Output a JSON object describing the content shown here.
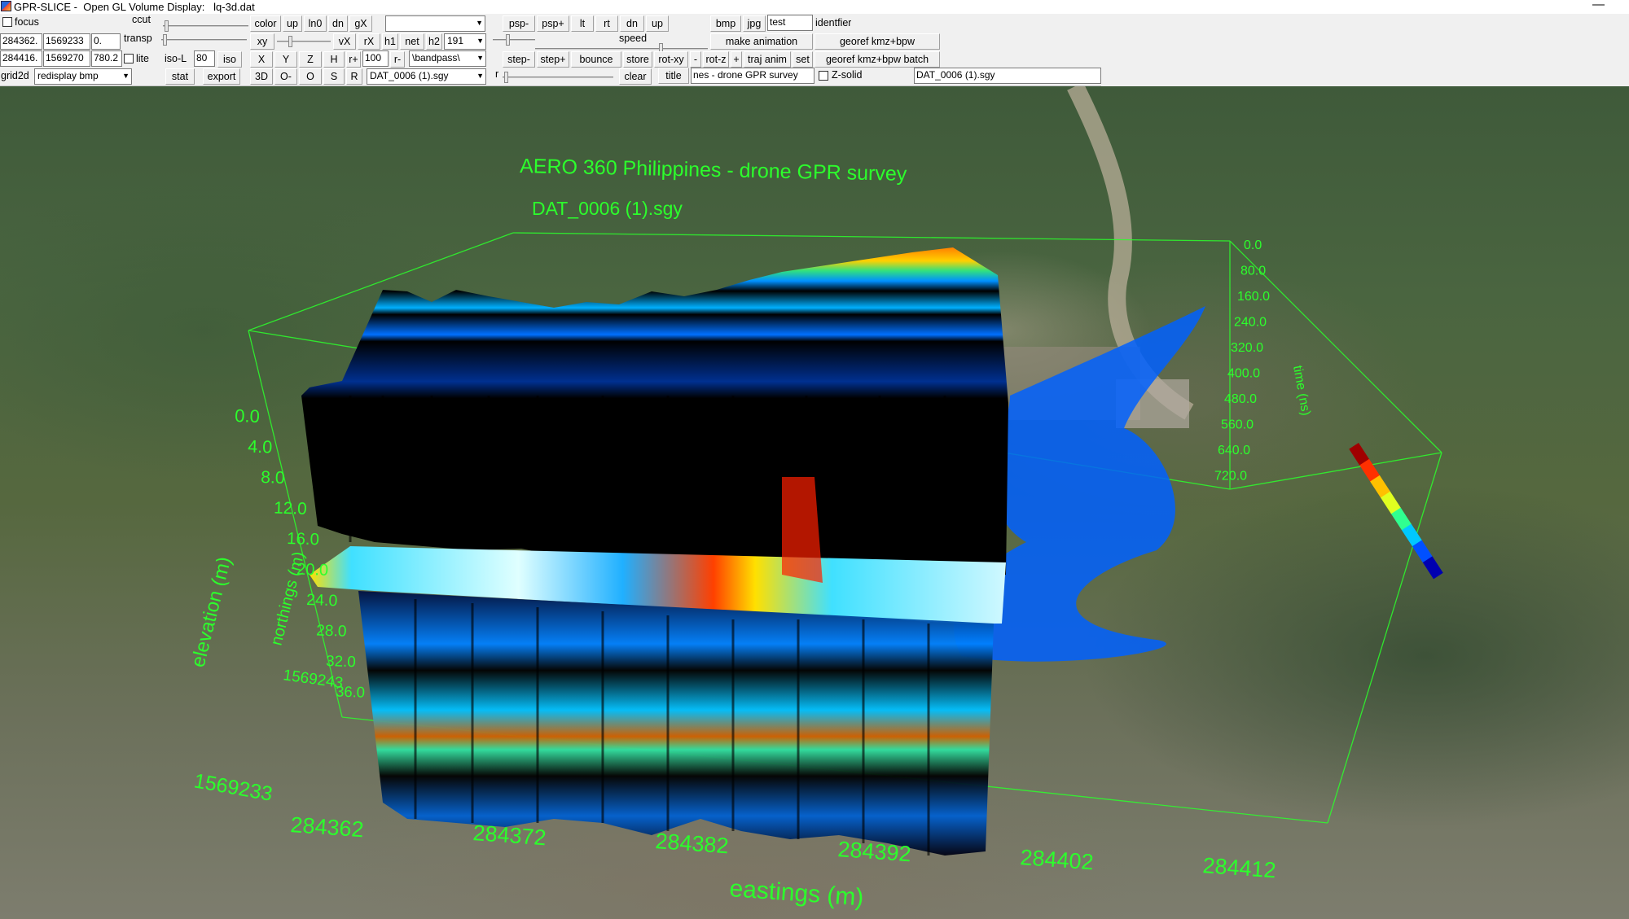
{
  "window": {
    "title": "GPR-SLICE -  Open GL Volume Display:   lq-3d.dat",
    "minimize": "—"
  },
  "toolbar": {
    "focus_label": "focus",
    "ccut_label": "ccut",
    "transp_label": "transp",
    "lite_label": "lite",
    "iso_l_label": "iso-L",
    "iso_value": "80",
    "iso_label": "iso",
    "grid2d_label": "grid2d",
    "redisplay_option": "redisplay bmp",
    "coord_row1": [
      "284362.",
      "1569233",
      "0."
    ],
    "coord_row2": [
      "284416.",
      "1569270",
      "780.2"
    ],
    "color": "color",
    "up": "up",
    "ln0": "ln0",
    "dn": "dn",
    "gx": "gX",
    "xy": "xy",
    "vx": "vX",
    "rx": "rX",
    "h1": "h1",
    "net": "net",
    "h2": "h2",
    "h2_value": "191",
    "stat": "stat",
    "export": "export",
    "x": "X",
    "y": "Y",
    "z": "Z",
    "h": "H",
    "r_plus": "r+",
    "r_value": "100",
    "r_minus": "r-",
    "filter_option": "\\bandpass\\",
    "view_3d": "3D",
    "o_minus": "O-",
    "o": "O",
    "s": "S",
    "r": "R",
    "file_option": "DAT_0006 (1).sgy",
    "r_slider_label": "r",
    "psp_minus": "psp-",
    "psp_plus": "psp+",
    "lt": "lt",
    "rt": "rt",
    "dn2": "dn",
    "up2": "up",
    "speed_label": "speed",
    "step_minus": "step-",
    "step_plus": "step+",
    "bounce": "bounce",
    "store": "store",
    "rot_xy": "rot-xy",
    "minus": "-",
    "rot_z": "rot-z",
    "plus": "+",
    "traj_anim": "traj anim",
    "set": "set",
    "clear": "clear",
    "title_btn": "title",
    "title_value": "nes - drone GPR survey",
    "zsolid_label": "Z-solid",
    "file_name": "DAT_0006 (1).sgy",
    "bmp": "bmp",
    "jpg": "jpg",
    "identifier_value": "test",
    "identifier_label": "identfier",
    "make_animation": "make animation",
    "georef": "georef kmz+bpw",
    "georef_batch": "georef kmz+bpw batch"
  },
  "viewport": {
    "title": "AERO 360 Philippines - drone GPR survey",
    "subtitle": "DAT_0006 (1).sgy",
    "elevation_label": "elevation (m)",
    "northings_label": "northings (m)",
    "time_label": "time (ns)",
    "eastings_label": "eastings (m)",
    "elevation_ticks": [
      "0.0",
      "4.0",
      "8.0",
      "12.0",
      "16.0",
      "20.0",
      "24.0",
      "28.0",
      "32.0",
      "36.0"
    ],
    "time_ticks": [
      "0.0",
      "80.0",
      "160.0",
      "240.0",
      "320.0",
      "400.0",
      "480.0",
      "560.0",
      "640.0",
      "720.0"
    ],
    "easting_ticks": [
      "284362",
      "284372",
      "284382",
      "284392",
      "284402",
      "284412"
    ],
    "northing_ticks": [
      "1569233",
      "1569243"
    ],
    "label_color": "#2cff2c",
    "colormap": [
      "#0000b0",
      "#0050ff",
      "#00c8ff",
      "#30ff90",
      "#e0ff20",
      "#ffc000",
      "#ff3000",
      "#a00000"
    ]
  }
}
